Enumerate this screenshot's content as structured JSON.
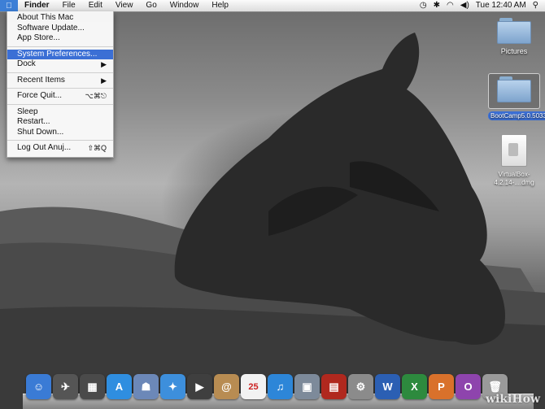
{
  "menubar": {
    "apple_icon": "apple-icon",
    "items": [
      "Finder",
      "File",
      "Edit",
      "View",
      "Go",
      "Window",
      "Help"
    ],
    "clock": "Tue 12:40 AM",
    "status_icons": [
      "time-machine-icon",
      "bluetooth-icon",
      "wifi-icon",
      "volume-icon",
      "spotlight-icon"
    ]
  },
  "apple_menu": {
    "items": [
      {
        "label": "About This Mac",
        "shortcut": ""
      },
      {
        "label": "Software Update...",
        "shortcut": ""
      },
      {
        "label": "App Store...",
        "shortcut": ""
      },
      {
        "label": "System Preferences...",
        "shortcut": "",
        "selected": true
      },
      {
        "label": "Dock",
        "shortcut": "▶"
      },
      {
        "label": "Recent Items",
        "shortcut": "▶"
      },
      {
        "label": "Force Quit...",
        "shortcut": "⌥⌘⎋"
      },
      {
        "label": "Sleep",
        "shortcut": ""
      },
      {
        "label": "Restart...",
        "shortcut": ""
      },
      {
        "label": "Shut Down...",
        "shortcut": ""
      },
      {
        "label": "Log Out Anuj...",
        "shortcut": "⇧⌘Q"
      }
    ]
  },
  "desktop_icons": [
    {
      "label": "Pictures",
      "icon": "folder-icon"
    },
    {
      "label": "BootCamp5.0.5033",
      "icon": "folder-icon",
      "selected": true
    },
    {
      "label": "VirtualBox-4.2.14-....dmg",
      "icon": "disk-image-icon"
    }
  ],
  "dock": {
    "items": [
      {
        "name": "finder",
        "color": "#3a7bd5",
        "glyph": "☺"
      },
      {
        "name": "launchpad",
        "color": "#555555",
        "glyph": "✈"
      },
      {
        "name": "mission-control",
        "color": "#4a4a4a",
        "glyph": "▦"
      },
      {
        "name": "app-store",
        "color": "#2f8ee0",
        "glyph": "A"
      },
      {
        "name": "preview",
        "color": "#6c88b8",
        "glyph": "☗"
      },
      {
        "name": "safari",
        "color": "#3d8fdc",
        "glyph": "✦"
      },
      {
        "name": "facetime",
        "color": "#3f3f3f",
        "glyph": "▶"
      },
      {
        "name": "contacts",
        "color": "#b88c52",
        "glyph": "@"
      },
      {
        "name": "calendar",
        "color": "#f2f2f2",
        "glyph": "25"
      },
      {
        "name": "itunes",
        "color": "#2d86d8",
        "glyph": "♫"
      },
      {
        "name": "iphoto",
        "color": "#7d8a9a",
        "glyph": "▣"
      },
      {
        "name": "photo-booth",
        "color": "#b0281e",
        "glyph": "▤"
      },
      {
        "name": "system-preferences",
        "color": "#8b8b8b",
        "glyph": "⚙"
      },
      {
        "name": "word",
        "color": "#2b5fb3",
        "glyph": "W"
      },
      {
        "name": "excel",
        "color": "#2d8a3e",
        "glyph": "X"
      },
      {
        "name": "powerpoint",
        "color": "#d9712b",
        "glyph": "P"
      },
      {
        "name": "onenote",
        "color": "#8e44ad",
        "glyph": "O"
      },
      {
        "name": "trash",
        "color": "#9a9a9a",
        "glyph": "🗑"
      }
    ]
  },
  "watermark": "wikiHow"
}
